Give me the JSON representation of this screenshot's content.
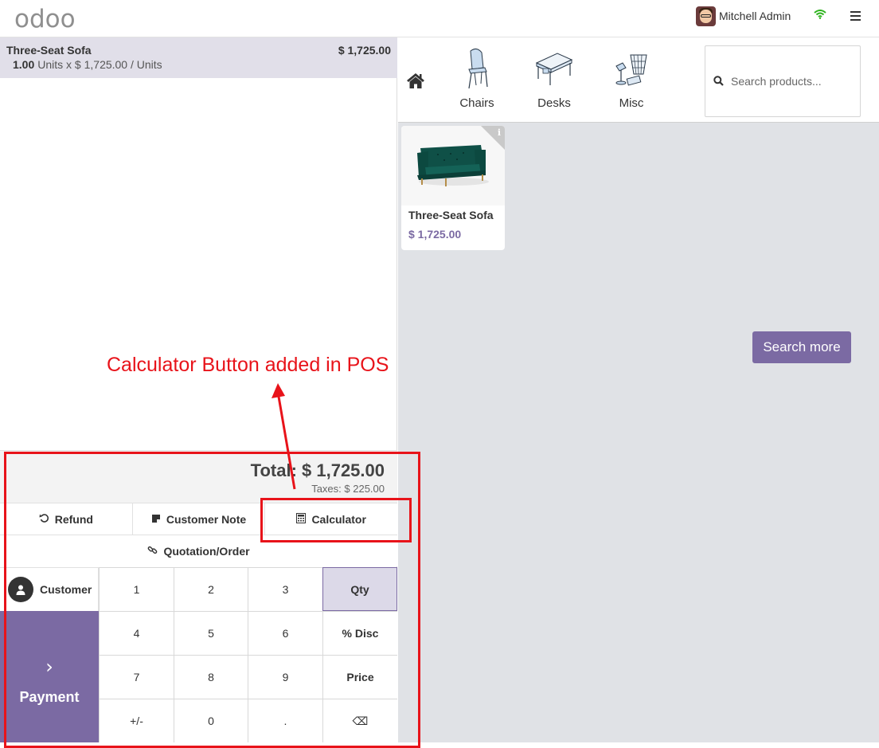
{
  "header": {
    "logo": "odoo",
    "user_name": "Mitchell Admin",
    "wifi_icon": "wifi-icon",
    "menu_icon": "hamburger-menu-icon",
    "wifi_color": "#2db31d"
  },
  "order": {
    "lines": [
      {
        "product": "Three-Seat Sofa",
        "price": "$ 1,725.00",
        "qty": "1.00",
        "detail": "Units x $ 1,725.00 / Units"
      }
    ],
    "total": "Total: $ 1,725.00",
    "taxes": "Taxes: $ 225.00"
  },
  "controls": {
    "refund": "Refund",
    "customer_note": "Customer Note",
    "calculator": "Calculator",
    "quotation": "Quotation/Order"
  },
  "numpad": {
    "customer": "Customer",
    "payment": "Payment",
    "payment_chevron": "›",
    "keys": [
      "1",
      "2",
      "3",
      "Qty",
      "4",
      "5",
      "6",
      "% Disc",
      "7",
      "8",
      "9",
      "Price",
      "+/-",
      "0",
      ".",
      "⌫"
    ],
    "active_mode": "Qty"
  },
  "categories": {
    "home_icon": "home-icon",
    "items": [
      {
        "label": "Chairs",
        "icon": "chair-icon"
      },
      {
        "label": "Desks",
        "icon": "desk-icon"
      },
      {
        "label": "Misc",
        "icon": "misc-icon"
      }
    ]
  },
  "search": {
    "placeholder": "Search products..."
  },
  "products": [
    {
      "name": "Three-Seat Sofa",
      "price": "$ 1,725.00",
      "info": "i"
    }
  ],
  "search_more": "Search more",
  "annotation": {
    "text": "Calculator Button added in POS",
    "color": "#e8131a"
  },
  "colors": {
    "brand": "#7b6aa3",
    "selected_line": "#e1dfe9",
    "background": "#e0e2e6"
  }
}
